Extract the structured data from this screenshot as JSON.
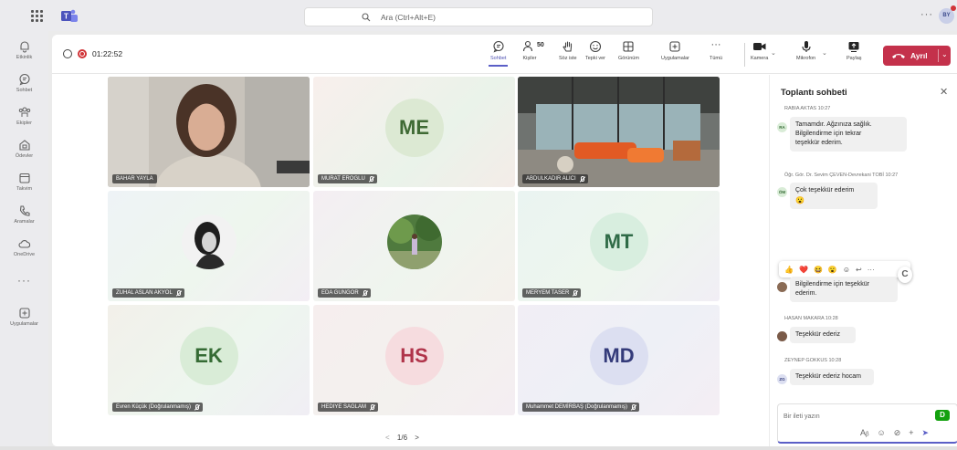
{
  "search": {
    "placeholder": "Ara (Ctrl+Alt+E)"
  },
  "user_avatar": "BY",
  "rail": {
    "items": [
      {
        "label": "Etkinlik",
        "icon": "bell-icon"
      },
      {
        "label": "Sohbet",
        "icon": "chat-icon"
      },
      {
        "label": "Ekipler",
        "icon": "teams-icon"
      },
      {
        "label": "Ödevler",
        "icon": "assignments-icon"
      },
      {
        "label": "Takvim",
        "icon": "calendar-icon"
      },
      {
        "label": "Aramalar",
        "icon": "phone-icon"
      },
      {
        "label": "OneDrive",
        "icon": "cloud-icon"
      },
      {
        "label": "Uygulamalar",
        "icon": "apps-icon"
      }
    ]
  },
  "meeting": {
    "timer": "01:22:52",
    "tools": {
      "chat": "Sohbet",
      "people": "Kişiler",
      "people_count": "50",
      "raise_hand": "Söz iste",
      "react": "Tepki ver",
      "view": "Görünüm",
      "apps": "Uygulamalar",
      "more": "Tümü",
      "camera": "Kamera",
      "mic": "Mikrofon",
      "share": "Paylaş"
    },
    "leave_label": "Ayrıl"
  },
  "tiles": [
    {
      "name": "BAHAR YAYLA",
      "type": "video"
    },
    {
      "name": "MURAT EROGLU",
      "type": "initials",
      "initials": "ME",
      "color": "#dce9d3"
    },
    {
      "name": "ABDULKADIR ALICI",
      "type": "video"
    },
    {
      "name": "ZUHAL ASLAN AKYOL",
      "type": "photo"
    },
    {
      "name": "EDA GUNGOR",
      "type": "photo"
    },
    {
      "name": "MERYEM TASER",
      "type": "initials",
      "initials": "MT",
      "color": "#d8eedf"
    },
    {
      "name": "Evren Küçük (Doğrulanmamış)",
      "type": "initials",
      "initials": "EK",
      "color": "#d9ecd7"
    },
    {
      "name": "HEDIYE SAGLAM",
      "type": "initials",
      "initials": "HS",
      "color": "#f6dcdf"
    },
    {
      "name": "Muhammet DEMİRBAŞ (Doğrulanmamış)",
      "type": "initials",
      "initials": "MD",
      "color": "#dcdff1"
    }
  ],
  "pager": {
    "label": "1/6"
  },
  "chat": {
    "title": "Toplantı sohbeti",
    "messages": [
      {
        "meta": "RABIA AKTAS 10:27",
        "initials": "RA",
        "lines": [
          "Tamamdır. Ağzınıza sağlık.",
          "Bilgilendirme için tekrar",
          "teşekkür ederim."
        ]
      },
      {
        "meta": "Öğr. Gör. Dr. Sevim ÇEVEN-Devrekani TOBİ 10:27",
        "initials": "ÖM",
        "lines": [
          "Çok teşekkür ederim"
        ]
      },
      {
        "meta": "",
        "initials": "",
        "lines": [
          "Bilgilendirme için teşekkür",
          "ederim."
        ]
      },
      {
        "meta": "HASAN MAKARA 10:28",
        "initials": "",
        "lines": [
          "Teşekkür ederiz"
        ]
      },
      {
        "meta": "ZEYNEP GOKKUS 10:28",
        "initials": "ZG",
        "lines": [
          "Teşekkür ederiz hocam"
        ]
      }
    ],
    "compose_placeholder": "Bir ileti yazın"
  }
}
